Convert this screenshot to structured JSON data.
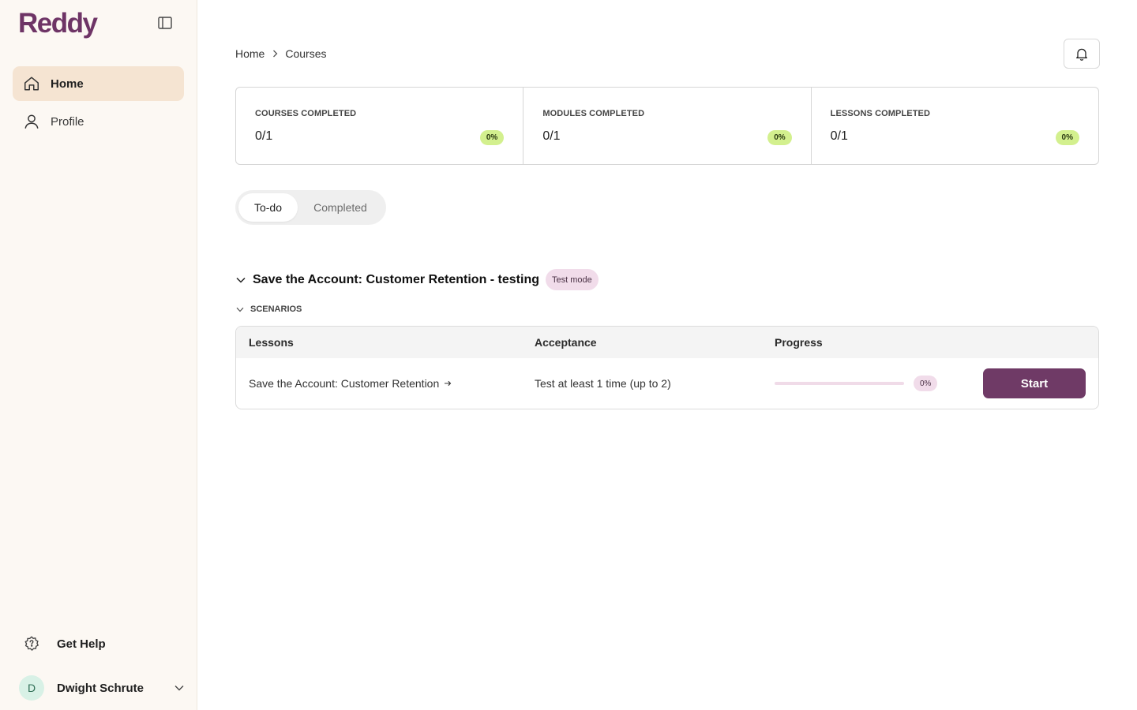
{
  "brand": {
    "logo": "Reddy",
    "accent": "#6e3466"
  },
  "sidebar": {
    "collapse_icon": "sidebar-toggle-icon",
    "items": [
      {
        "label": "Home",
        "icon": "home-icon",
        "active": true
      },
      {
        "label": "Profile",
        "icon": "user-icon",
        "active": false
      }
    ],
    "help": {
      "label": "Get Help",
      "icon": "help-icon"
    },
    "user": {
      "initial": "D",
      "name": "Dwight Schrute"
    }
  },
  "header": {
    "breadcrumb": [
      "Home",
      "Courses"
    ],
    "bell_icon": "bell-icon"
  },
  "stats": [
    {
      "label": "COURSES COMPLETED",
      "value": "0/1",
      "percent": "0%"
    },
    {
      "label": "MODULES COMPLETED",
      "value": "0/1",
      "percent": "0%"
    },
    {
      "label": "LESSONS COMPLETED",
      "value": "0/1",
      "percent": "0%"
    }
  ],
  "tabs": [
    {
      "label": "To-do",
      "active": true
    },
    {
      "label": "Completed",
      "active": false
    }
  ],
  "course": {
    "title": "Save the Account: Customer Retention - testing",
    "badge": "Test mode",
    "section": "SCENARIOS",
    "columns": [
      "Lessons",
      "Acceptance",
      "Progress"
    ],
    "rows": [
      {
        "lesson": "Save the Account: Customer Retention",
        "acceptance": "Test at least 1 time (up to 2)",
        "progress": 0,
        "progress_label": "0%",
        "action": "Start"
      }
    ]
  }
}
